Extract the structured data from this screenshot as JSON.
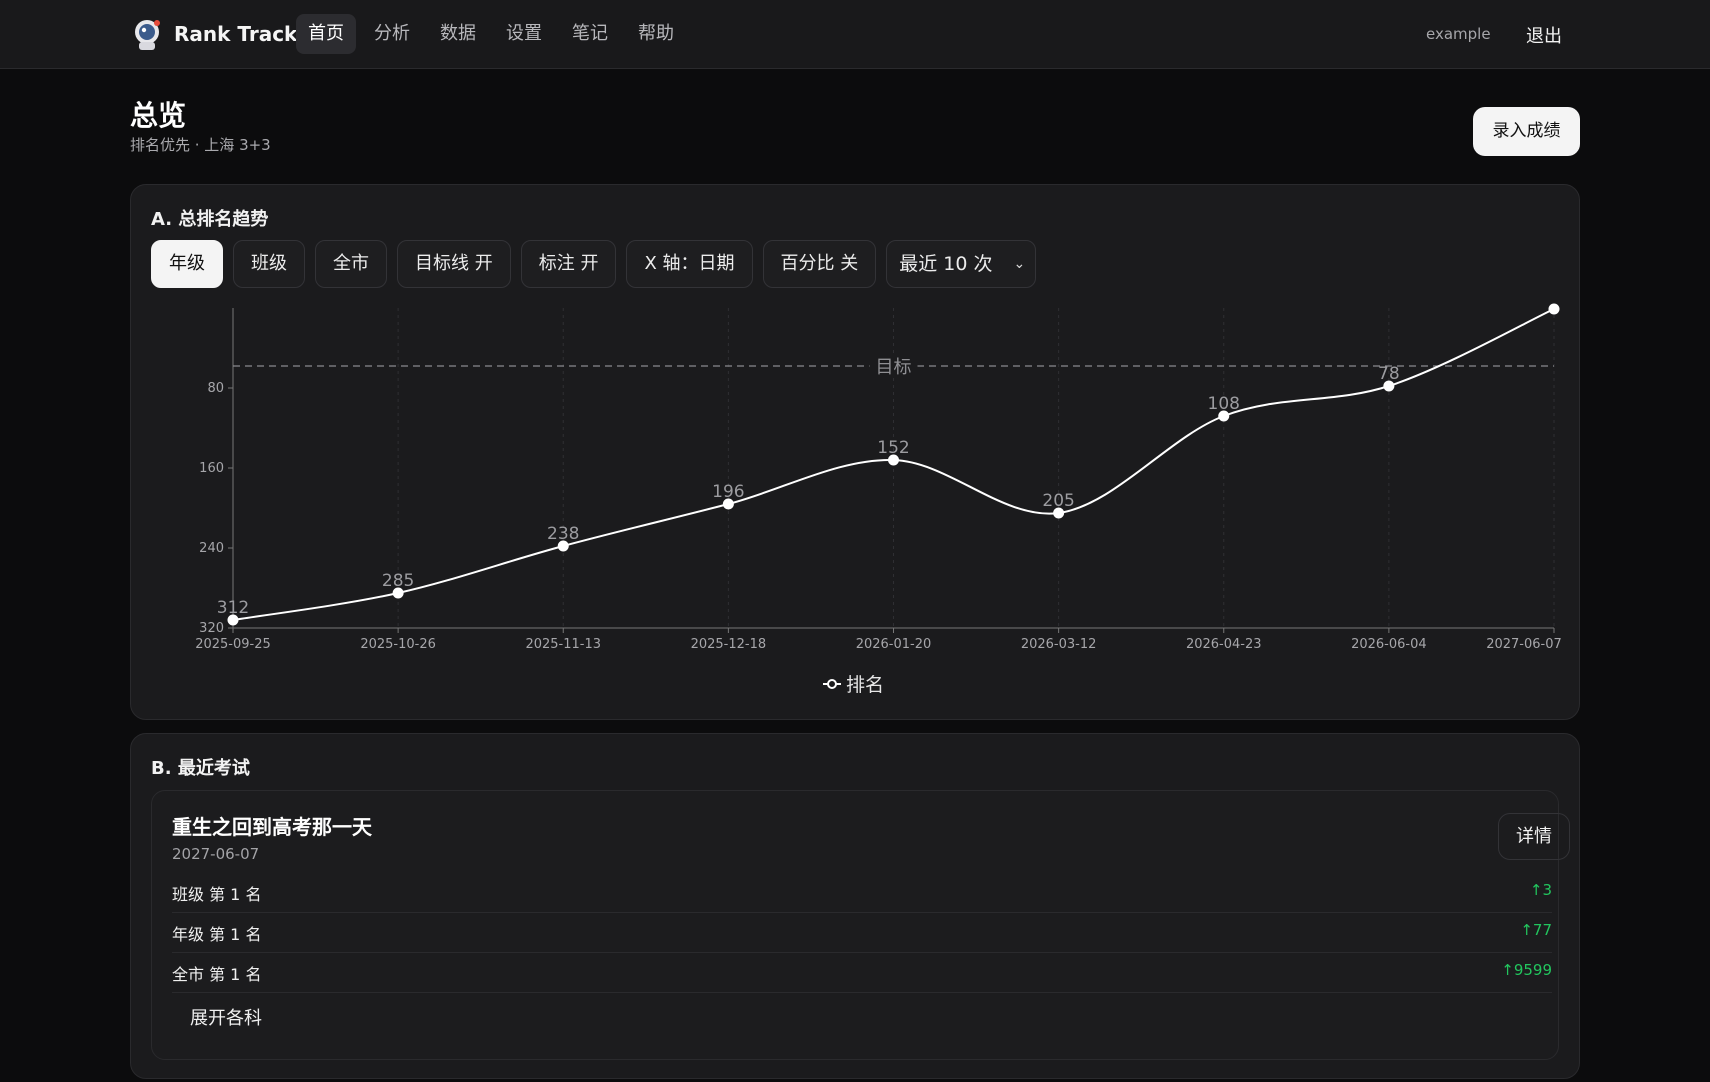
{
  "nav": {
    "brand": "Rank Track",
    "items": [
      {
        "label": "首页",
        "active": true
      },
      {
        "label": "分析",
        "active": false
      },
      {
        "label": "数据",
        "active": false
      },
      {
        "label": "设置",
        "active": false
      },
      {
        "label": "笔记",
        "active": false
      },
      {
        "label": "帮助",
        "active": false
      }
    ],
    "user": "example",
    "logout": "退出"
  },
  "header": {
    "title": "总览",
    "subtitle": "排名优先 · 上海 3+3",
    "record_button": "录入成绩"
  },
  "trend": {
    "title": "A. 总排名趋势",
    "controls": {
      "grade": "年级",
      "class": "班级",
      "city": "全市",
      "target_line": "目标线 开",
      "labels": "标注 开",
      "x_axis": "X 轴：日期",
      "percent": "百分比 关",
      "range": "最近 10 次"
    }
  },
  "chart_data": {
    "type": "line",
    "x": [
      "2025-09-25",
      "2025-10-26",
      "2025-11-13",
      "2025-12-18",
      "2026-01-20",
      "2026-03-12",
      "2026-04-23",
      "2026-06-04",
      "2027-06-07"
    ],
    "series": [
      {
        "name": "排名",
        "values": [
          312,
          285,
          238,
          196,
          152,
          205,
          108,
          78,
          1
        ],
        "point_labels": [
          "312",
          "285",
          "238",
          "196",
          "152",
          "205",
          "108",
          "78",
          ""
        ]
      }
    ],
    "target": {
      "value": 58,
      "label": "目标"
    },
    "yticks": [
      "80",
      "160",
      "240",
      "320"
    ],
    "ylim": [
      320,
      0
    ],
    "y_inverted": true,
    "grid": true,
    "legend": "bottom-center",
    "colors": {
      "line": "#ffffff",
      "target": "#8a8a8e"
    }
  },
  "recent": {
    "title": "B. 最近考试",
    "exam": {
      "name": "重生之回到高考那一天",
      "date": "2027-06-07",
      "detail_button": "详情",
      "ranks": [
        {
          "label": "班级 第 1 名",
          "delta": "↑3"
        },
        {
          "label": "年级 第 1 名",
          "delta": "↑77"
        },
        {
          "label": "全市 第 1 名",
          "delta": "↑9599"
        }
      ],
      "expand_button": "展开各科"
    }
  }
}
